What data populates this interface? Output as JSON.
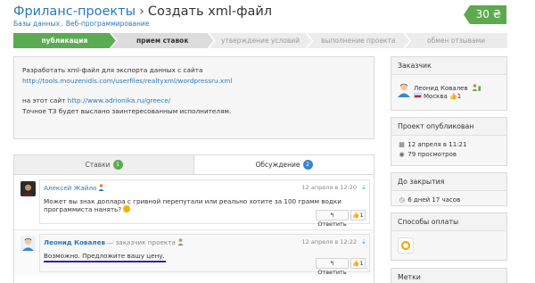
{
  "header": {
    "breadcrumb_link": "Фриланс-проекты",
    "separator": "›",
    "title": "Создать xml-файл",
    "sub_crumbs": [
      "Базы данных",
      "Веб-программирование"
    ],
    "sub_sep": ",",
    "price": "30 ₴"
  },
  "stepper": {
    "steps": [
      "публикация",
      "прием ставок",
      "утверждение условий",
      "выполнение проекта",
      "обмен отзывами"
    ],
    "active_index": 0
  },
  "description": {
    "line1": "Разработать xml-файл для экспорта данных с сайта",
    "link1": "http://tools.mouzenidis.com/userfiles/realtyxml/wordpressru.xml",
    "line2_prefix": "на этот сайт",
    "link2": "http://www.adrionika.ru/greece/",
    "line3": "Точное ТЗ будет выслано заинтересованным исполнителям."
  },
  "tabs": {
    "bids_label": "Ставки",
    "bids_count": "1",
    "discussion_label": "Обсуждение",
    "discussion_count": "2"
  },
  "comments": [
    {
      "author": "Алексей Жайло",
      "role": "",
      "time": "12 апреля в 12:20",
      "text": "Может вы знак доллара с гривной перепутали или реально хотите за 100 грамм водки программиста нанять?",
      "reply_label": "Ответить",
      "likes": "1"
    },
    {
      "author": "Леонид Ковалев",
      "role": "— заказчик проекта",
      "time": "12 апреля в 12:22",
      "text": "Возможно. Предложите вашу цену.",
      "reply_label": "Ответить",
      "likes": "1"
    }
  ],
  "sidebar": {
    "customer_title": "Заказчик",
    "customer_name": "Леонид Ковалев",
    "customer_city": "Москва",
    "customer_likes": "1",
    "published_title": "Проект опубликован",
    "published_date": "12 апреля в 11:21",
    "views": "79 просмотров",
    "deadline_title": "До закрытия",
    "deadline_value": "6 дней 17 часов",
    "payment_title": "Способы оплаты",
    "tags_title": "Метки"
  },
  "colors": {
    "accent_green": "#5bab52",
    "link_blue": "#2a78b8",
    "badge_blue": "#3b87c8",
    "underline_purple": "#3a1fa6"
  }
}
